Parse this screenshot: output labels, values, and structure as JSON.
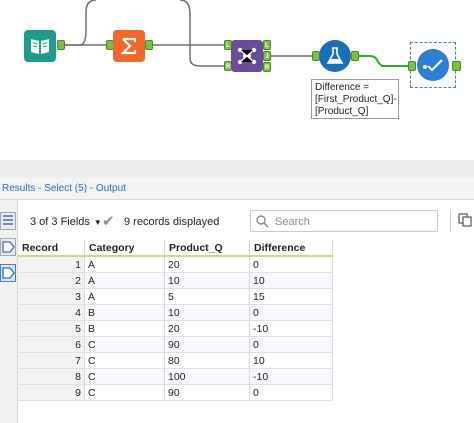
{
  "workflow": {
    "annotation_lines": [
      "Difference =",
      "[First_Product_Q]-",
      "[Product_Q]"
    ],
    "anchor_labels": [
      "L",
      "J",
      "R",
      "L",
      "J",
      "R"
    ]
  },
  "results": {
    "title": "Results - Select (5) - Output"
  },
  "toolbar": {
    "field_select": "3 of 3 Fields",
    "records_displayed": "9 records displayed",
    "search_placeholder": "Search"
  },
  "table": {
    "columns": [
      "Record",
      "Category",
      "Product_Q",
      "Difference"
    ],
    "rows": [
      [
        "1",
        "A",
        "20",
        "0"
      ],
      [
        "2",
        "A",
        "10",
        "10"
      ],
      [
        "3",
        "A",
        "5",
        "15"
      ],
      [
        "4",
        "B",
        "10",
        "0"
      ],
      [
        "5",
        "B",
        "20",
        "-10"
      ],
      [
        "6",
        "C",
        "90",
        "0"
      ],
      [
        "7",
        "C",
        "80",
        "10"
      ],
      [
        "8",
        "C",
        "100",
        "-10"
      ],
      [
        "9",
        "C",
        "90",
        "0"
      ]
    ]
  },
  "colors": {
    "accent_blue": "#2f6fb3",
    "anchor_green": "#7bc043",
    "input_tool_teal": "#1f9b8e",
    "summarize_orange": "#f0682a",
    "join_purple": "#6b4c9a",
    "formula_blue": "#1c6fb5",
    "select_blue": "#2a7fd4"
  }
}
